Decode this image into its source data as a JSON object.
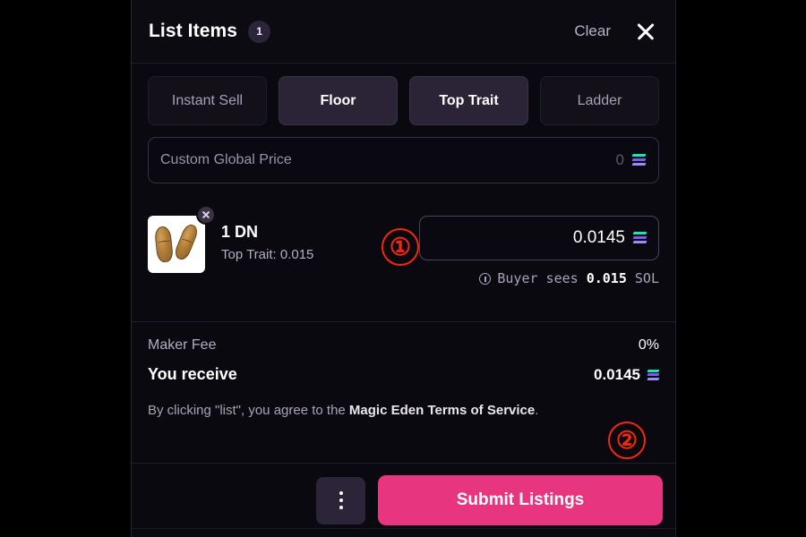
{
  "header": {
    "title": "List Items",
    "badge_count": "1",
    "clear_label": "Clear",
    "close_icon": "close-icon"
  },
  "tabs": [
    {
      "label": "Instant Sell",
      "active": false
    },
    {
      "label": "Floor",
      "active": true
    },
    {
      "label": "Top Trait",
      "active": true
    },
    {
      "label": "Ladder",
      "active": false
    }
  ],
  "global_price": {
    "placeholder": "Custom Global Price",
    "value": "",
    "suffix_zero": "0",
    "currency_icon": "solana-icon"
  },
  "item": {
    "name": "1 DN",
    "subtitle": "Top Trait: 0.015",
    "thumbnail_alt": "peanut-nft-thumbnail",
    "remove_icon": "close-icon",
    "price_value": "0.0145",
    "price_currency_icon": "solana-icon",
    "buyer_info_icon": "info-icon",
    "buyer_prefix": "Buyer sees ",
    "buyer_amount": "0.015",
    "buyer_suffix": " SOL"
  },
  "summary": {
    "maker_fee_label": "Maker Fee",
    "maker_fee_value": "0%",
    "you_receive_label": "You receive",
    "you_receive_value": "0.0145",
    "you_receive_currency_icon": "solana-icon"
  },
  "terms": {
    "prefix": "By clicking \"list\", you agree to the ",
    "link": "Magic Eden Terms of Service",
    "suffix": "."
  },
  "footer": {
    "kebab_icon": "more-vertical-icon",
    "submit_label": "Submit Listings"
  },
  "annotations": [
    {
      "label": "①"
    },
    {
      "label": "②"
    }
  ],
  "colors": {
    "accent_pink": "#e8357f",
    "panel_bg": "#0b0910",
    "tab_active_bg": "#2b2437",
    "annotation_red": "#f4280d"
  }
}
